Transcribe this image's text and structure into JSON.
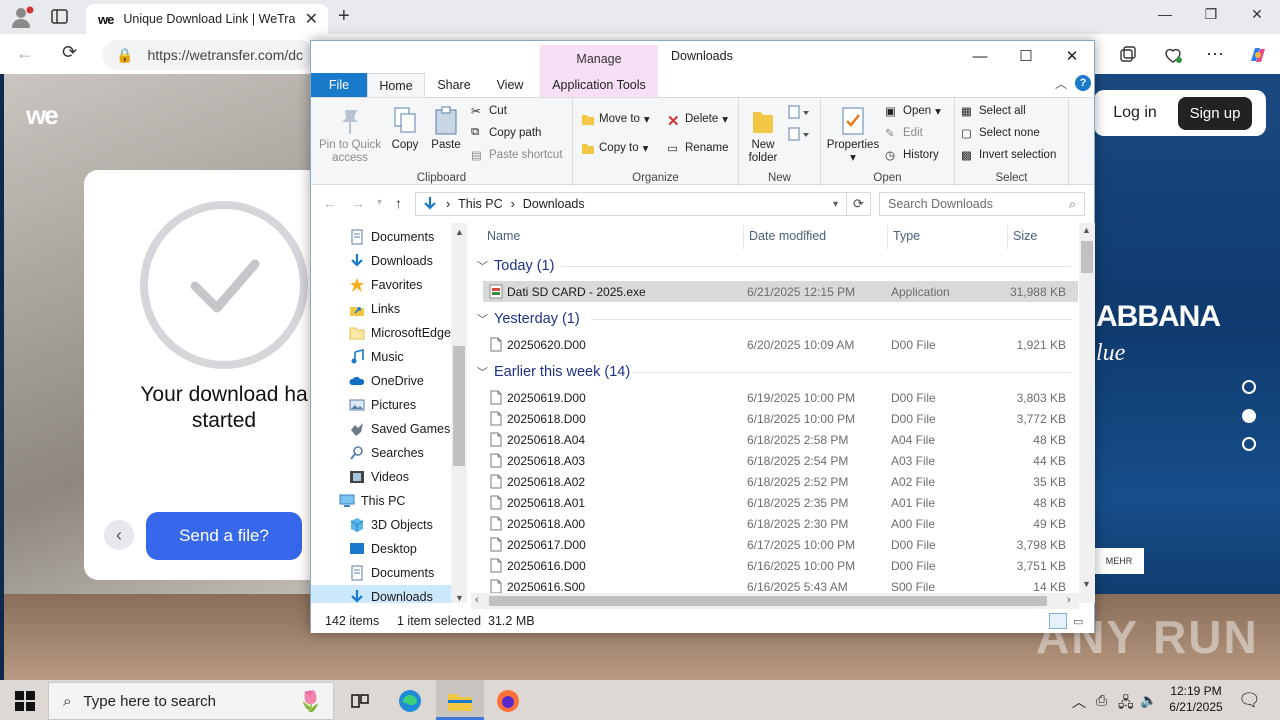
{
  "browser": {
    "tab_title": "Unique Download Link | WeTransfer",
    "tab_favicon": "we",
    "url": "https://wetransfer.com/dc",
    "new_tab": "+"
  },
  "wetransfer": {
    "logo": "we",
    "message": "Your download ha\nstarted",
    "send_button": "Send a file?",
    "login": "Log in",
    "signup": "Sign up",
    "ad_brand": "ABBANA",
    "ad_sub": "lue",
    "ad_more": "MEHR",
    "watermark": "ANY  RUN"
  },
  "explorer": {
    "manage": "Manage",
    "title": "Downloads",
    "tabs": {
      "file": "File",
      "home": "Home",
      "share": "Share",
      "view": "View",
      "app_tools": "Application Tools"
    },
    "clipboard": {
      "pin": "Pin to Quick access",
      "copy": "Copy",
      "paste": "Paste",
      "cut": "Cut",
      "copy_path": "Copy path",
      "paste_shortcut": "Paste shortcut",
      "label": "Clipboard"
    },
    "organize": {
      "move_to": "Move to",
      "copy_to": "Copy to",
      "delete": "Delete",
      "rename": "Rename",
      "label": "Organize"
    },
    "new": {
      "new_folder": "New folder",
      "label": "New"
    },
    "open": {
      "properties": "Properties",
      "open": "Open",
      "edit": "Edit",
      "history": "History",
      "label": "Open"
    },
    "select": {
      "select_all": "Select all",
      "select_none": "Select none",
      "invert": "Invert selection",
      "label": "Select"
    },
    "breadcrumb": {
      "root": "This PC",
      "folder": "Downloads"
    },
    "search_placeholder": "Search Downloads",
    "nav": [
      {
        "label": "Documents",
        "icon": "documents-icon"
      },
      {
        "label": "Downloads",
        "icon": "downloads-icon"
      },
      {
        "label": "Favorites",
        "icon": "favorites-icon"
      },
      {
        "label": "Links",
        "icon": "links-icon"
      },
      {
        "label": "MicrosoftEdge",
        "icon": "folder-icon"
      },
      {
        "label": "Music",
        "icon": "music-icon"
      },
      {
        "label": "OneDrive",
        "icon": "onedrive-icon"
      },
      {
        "label": "Pictures",
        "icon": "pictures-icon"
      },
      {
        "label": "Saved Games",
        "icon": "saved-games-icon"
      },
      {
        "label": "Searches",
        "icon": "searches-icon"
      },
      {
        "label": "Videos",
        "icon": "videos-icon"
      },
      {
        "label": "This PC",
        "icon": "this-pc-icon"
      },
      {
        "label": "3D Objects",
        "icon": "3d-objects-icon"
      },
      {
        "label": "Desktop",
        "icon": "desktop-icon"
      },
      {
        "label": "Documents",
        "icon": "documents-icon"
      },
      {
        "label": "Downloads",
        "icon": "downloads-icon"
      }
    ],
    "columns": {
      "name": "Name",
      "date": "Date modified",
      "type": "Type",
      "size": "Size"
    },
    "groups": [
      {
        "label": "Today (1)",
        "files": [
          {
            "name": "Dati SD CARD - 2025.exe",
            "date": "6/21/2025 12:15 PM",
            "type": "Application",
            "size": "31,988 KB",
            "icon": "application-icon"
          }
        ]
      },
      {
        "label": "Yesterday (1)",
        "files": [
          {
            "name": "20250620.D00",
            "date": "6/20/2025 10:09 AM",
            "type": "D00 File",
            "size": "1,921 KB",
            "icon": "file-icon"
          }
        ]
      },
      {
        "label": "Earlier this week (14)",
        "files": [
          {
            "name": "20250619.D00",
            "date": "6/19/2025 10:00 PM",
            "type": "D00 File",
            "size": "3,803 KB",
            "icon": "file-icon"
          },
          {
            "name": "20250618.D00",
            "date": "6/18/2025 10:00 PM",
            "type": "D00 File",
            "size": "3,772 KB",
            "icon": "file-icon"
          },
          {
            "name": "20250618.A04",
            "date": "6/18/2025 2:58 PM",
            "type": "A04 File",
            "size": "48 KB",
            "icon": "file-icon"
          },
          {
            "name": "20250618.A03",
            "date": "6/18/2025 2:54 PM",
            "type": "A03 File",
            "size": "44 KB",
            "icon": "file-icon"
          },
          {
            "name": "20250618.A02",
            "date": "6/18/2025 2:52 PM",
            "type": "A02 File",
            "size": "35 KB",
            "icon": "file-icon"
          },
          {
            "name": "20250618.A01",
            "date": "6/18/2025 2:35 PM",
            "type": "A01 File",
            "size": "48 KB",
            "icon": "file-icon"
          },
          {
            "name": "20250618.A00",
            "date": "6/18/2025 2:30 PM",
            "type": "A00 File",
            "size": "49 KB",
            "icon": "file-icon"
          },
          {
            "name": "20250617.D00",
            "date": "6/17/2025 10:00 PM",
            "type": "D00 File",
            "size": "3,798 KB",
            "icon": "file-icon"
          },
          {
            "name": "20250616.D00",
            "date": "6/16/2025 10:00 PM",
            "type": "D00 File",
            "size": "3,751 KB",
            "icon": "file-icon"
          },
          {
            "name": "20250616.S00",
            "date": "6/16/2025 5:43 AM",
            "type": "S00 File",
            "size": "14 KB",
            "icon": "file-icon"
          }
        ]
      }
    ],
    "status": {
      "count": "142 items",
      "selected": "1 item selected  31.2 MB"
    }
  },
  "taskbar": {
    "search_placeholder": "Type here to search",
    "time": "12:19 PM",
    "date": "6/21/2025"
  },
  "colors": {
    "accent": "#1979ca",
    "send_button": "#3767ea",
    "manage_tab": "#f7e0f5",
    "selection": "#cce8ff"
  }
}
